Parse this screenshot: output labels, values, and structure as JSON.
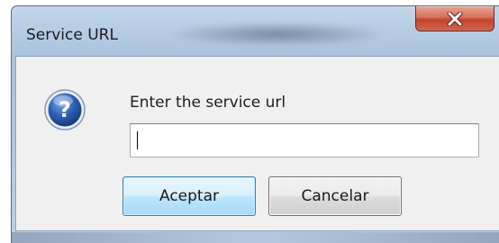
{
  "window": {
    "title": "Service URL"
  },
  "dialog": {
    "prompt": "Enter the service url",
    "input_value": "",
    "icon": "question-icon"
  },
  "buttons": {
    "accept_label": "Aceptar",
    "cancel_label": "Cancelar"
  },
  "colors": {
    "close_button": "#c3432d",
    "default_button_border": "#3c7fb1",
    "icon_blue": "#1f4f9c"
  }
}
